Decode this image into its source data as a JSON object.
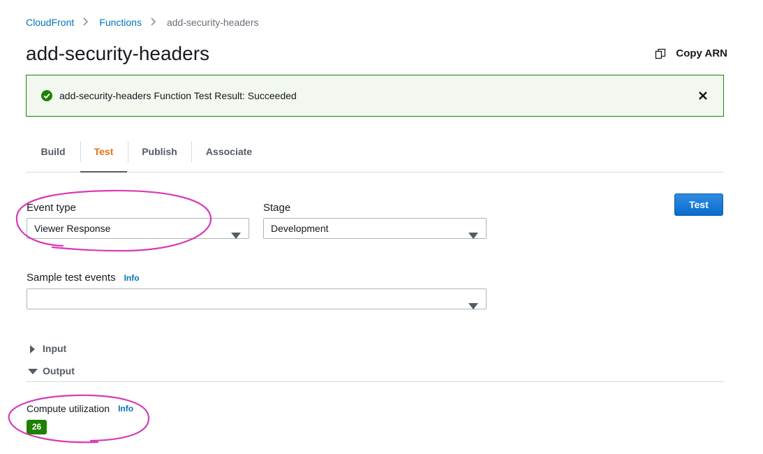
{
  "breadcrumb": {
    "items": [
      "CloudFront",
      "Functions",
      "add-security-headers"
    ]
  },
  "page": {
    "title": "add-security-headers",
    "copy_arn_label": "Copy ARN"
  },
  "flash": {
    "message": "add-security-headers Function Test Result: Succeeded",
    "status_color": "#1d8102"
  },
  "tabs": [
    {
      "label": "Build",
      "active": false
    },
    {
      "label": "Test",
      "active": true
    },
    {
      "label": "Publish",
      "active": false
    },
    {
      "label": "Associate",
      "active": false
    }
  ],
  "form": {
    "event_type": {
      "label": "Event type",
      "value": "Viewer Response"
    },
    "stage": {
      "label": "Stage",
      "value": "Development"
    },
    "sample_events": {
      "label": "Sample test events",
      "info": "Info",
      "value": ""
    },
    "test_button": "Test"
  },
  "sections": {
    "input": {
      "label": "Input",
      "expanded": false
    },
    "output": {
      "label": "Output",
      "expanded": true
    }
  },
  "output": {
    "compute_label": "Compute utilization",
    "compute_info": "Info",
    "compute_value": "26"
  },
  "colors": {
    "link": "#0073bb",
    "active_tab": "#ec7211",
    "primary_button": "#0a6ccc",
    "annotation": "#d63ab8"
  }
}
